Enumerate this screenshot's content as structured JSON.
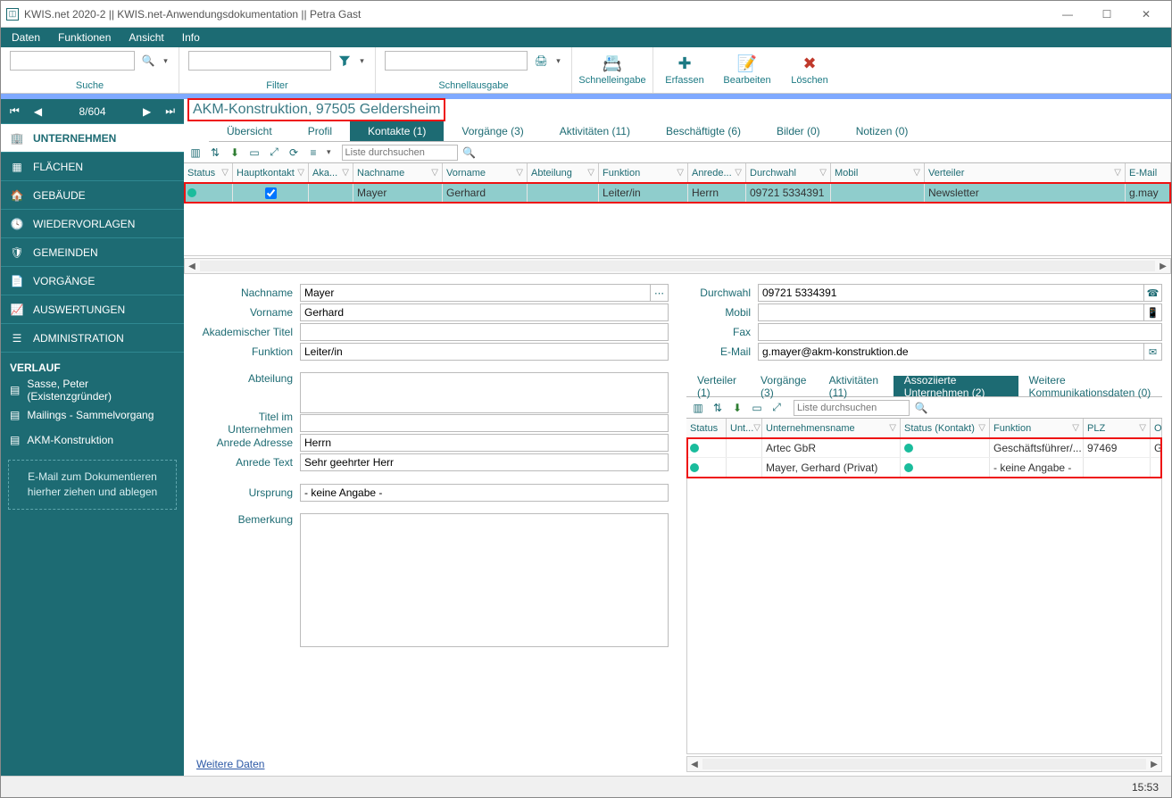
{
  "window": {
    "title": "KWIS.net 2020-2 || KWIS.net-Anwendungsdokumentation || Petra Gast"
  },
  "menu": {
    "items": [
      "Daten",
      "Funktionen",
      "Ansicht",
      "Info"
    ]
  },
  "toolbar": {
    "search_label": "Suche",
    "filter_label": "Filter",
    "quickoutput_label": "Schnellausgabe",
    "quickinput_label": "Schnelleingabe",
    "create_label": "Erfassen",
    "edit_label": "Bearbeiten",
    "delete_label": "Löschen",
    "search_value": "",
    "filter_value": "",
    "quickoutput_value": ""
  },
  "sidebar": {
    "counter": "8/604",
    "items": [
      {
        "label": "UNTERNEHMEN",
        "active": true
      },
      {
        "label": "FLÄCHEN"
      },
      {
        "label": "GEBÄUDE"
      },
      {
        "label": "WIEDERVORLAGEN"
      },
      {
        "label": "GEMEINDEN"
      },
      {
        "label": "VORGÄNGE"
      },
      {
        "label": "AUSWERTUNGEN"
      },
      {
        "label": "ADMINISTRATION"
      }
    ],
    "history_label": "VERLAUF",
    "history": [
      "Sasse, Peter (Existenzgründer)",
      "Mailings - Sammelvorgang",
      "AKM-Konstruktion"
    ],
    "hint_line1": "E-Mail  zum Dokumentieren",
    "hint_line2": "hierher ziehen und ablegen"
  },
  "heading": "AKM-Konstruktion, 97505 Geldersheim",
  "record_tabs": [
    {
      "label": "Übersicht"
    },
    {
      "label": "Profil"
    },
    {
      "label": "Kontakte (1)",
      "active": true
    },
    {
      "label": "Vorgänge (3)"
    },
    {
      "label": "Aktivitäten (11)"
    },
    {
      "label": "Beschäftigte (6)"
    },
    {
      "label": "Bilder (0)"
    },
    {
      "label": "Notizen (0)"
    }
  ],
  "grid": {
    "search_placeholder": "Liste durchsuchen",
    "columns": [
      "Status",
      "Hauptkontakt",
      "Aka...",
      "Nachname",
      "Vorname",
      "Abteilung",
      "Funktion",
      "Anrede...",
      "Durchwahl",
      "Mobil",
      "Verteiler",
      "E-Mail"
    ],
    "row": {
      "haupt_checked": true,
      "nachname": "Mayer",
      "vorname": "Gerhard",
      "abteilung": "",
      "funktion": "Leiter/in",
      "anrede": "Herrn",
      "durchwahl": "09721 5334391",
      "mobil": "",
      "verteiler": "Newsletter",
      "email": "g.may"
    }
  },
  "detail_left": {
    "labels": {
      "nachname": "Nachname",
      "vorname": "Vorname",
      "akad": "Akademischer Titel",
      "funktion": "Funktion",
      "abteilung": "Abteilung",
      "titel_unt": "Titel im Unternehmen",
      "anrede_adr": "Anrede Adresse",
      "anrede_text": "Anrede Text",
      "ursprung": "Ursprung",
      "bemerkung": "Bemerkung"
    },
    "values": {
      "nachname": "Mayer",
      "vorname": "Gerhard",
      "akad": "",
      "funktion": "Leiter/in",
      "abteilung": "",
      "titel_unt": "",
      "anrede_adr": "Herrn",
      "anrede_text": "Sehr geehrter Herr",
      "ursprung": "- keine Angabe -",
      "bemerkung": ""
    }
  },
  "detail_right": {
    "labels": {
      "durchwahl": "Durchwahl",
      "mobil": "Mobil",
      "fax": "Fax",
      "email": "E-Mail"
    },
    "values": {
      "durchwahl": "09721 5334391",
      "mobil": "",
      "fax": "",
      "email": "g.mayer@akm-konstruktion.de"
    }
  },
  "subtabs": [
    {
      "label": "Verteiler (1)"
    },
    {
      "label": "Vorgänge (3)"
    },
    {
      "label": "Aktivitäten (11)"
    },
    {
      "label": "Assoziierte Unternehmen (2)",
      "active": true
    },
    {
      "label": "Weitere Kommunikationsdaten (0)"
    }
  ],
  "subgrid": {
    "search_placeholder": "Liste durchsuchen",
    "columns": [
      "Status",
      "Unt...",
      "Unternehmensname",
      "Status (Kontakt)",
      "Funktion",
      "PLZ",
      "Ort"
    ],
    "rows": [
      {
        "name": "Artec GbR",
        "funktion": "Geschäftsführer/...",
        "plz": "97469",
        "ort": "Gochsheim"
      },
      {
        "name": "Mayer, Gerhard (Privat)",
        "funktion": "- keine Angabe -",
        "plz": "",
        "ort": ""
      }
    ]
  },
  "footer_link": "Weitere Daten",
  "statusbar_time": "15:53"
}
